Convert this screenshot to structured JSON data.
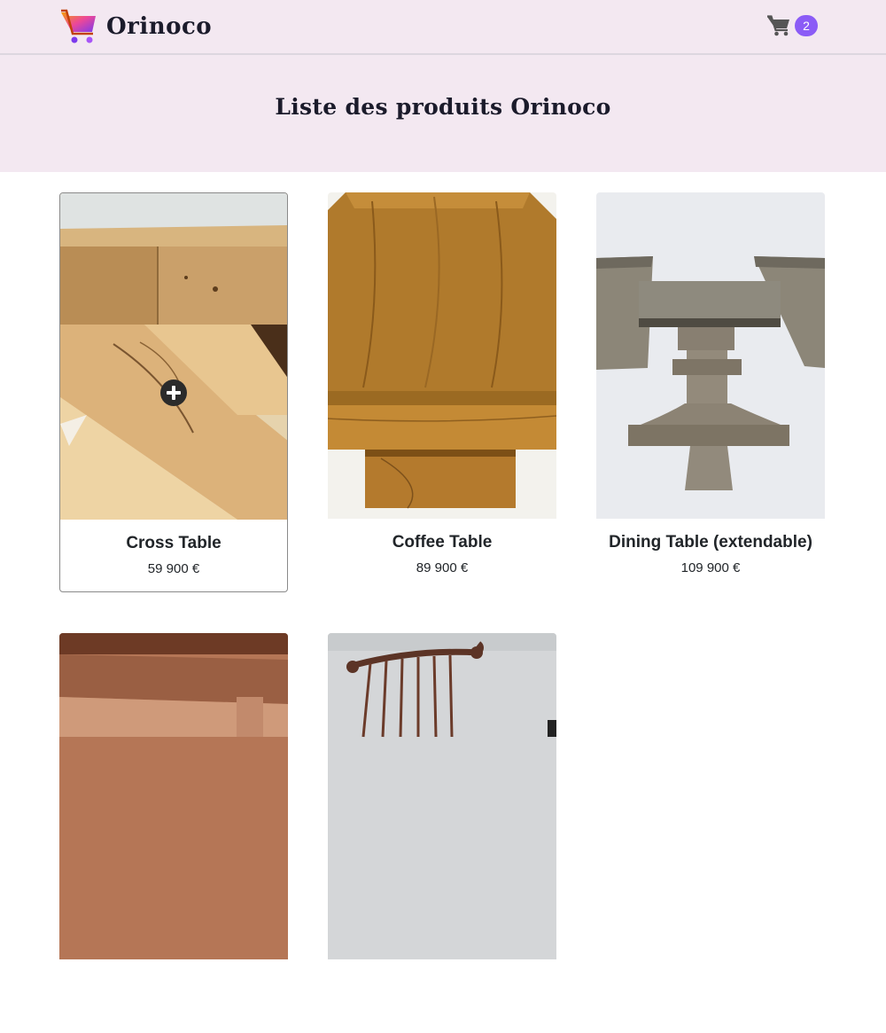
{
  "header": {
    "brand_name": "Orinoco",
    "brand_icon": "shopping-cart-logo-icon",
    "cart_icon": "shopping-cart-icon",
    "cart_count": "2",
    "colors": {
      "background": "#f3e8f1",
      "badge": "#8b5cf6"
    }
  },
  "hero": {
    "title": "Liste des produits Orinoco"
  },
  "products": [
    {
      "name": "Cross Table",
      "price": "59 900 €",
      "image": "oak-cross-table-photo"
    },
    {
      "name": "Coffee Table",
      "price": "89 900 €",
      "image": "oak-coffee-table-photo"
    },
    {
      "name": "Dining Table (extendable)",
      "price": "109 900 €",
      "image": "extendable-dining-table-photo"
    },
    {
      "name": "",
      "price": "",
      "image": "wood-furniture-photo"
    },
    {
      "name": "",
      "price": "",
      "image": "windsor-chair-photo"
    }
  ],
  "hover_icon": "plus-circle-icon"
}
